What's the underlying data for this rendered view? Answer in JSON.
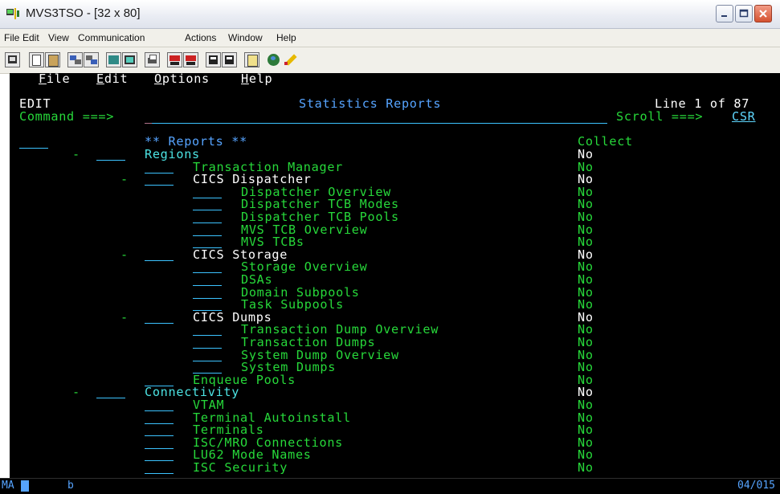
{
  "window": {
    "title": "MVS3TSO - [32 x 80]"
  },
  "menubar": [
    "File",
    "Edit",
    "View",
    "Communication",
    "Actions",
    "Window",
    "Help"
  ],
  "toolbar_icons": [
    "display-icon",
    "copy-icon",
    "paste-icon",
    "send-icon",
    "receive-icon",
    "keypad-icon",
    "screen-icon",
    "print-icon",
    "macro-record-icon",
    "macro-stop-icon",
    "macro-play-icon",
    "macro-pause-icon",
    "clipboard-icon",
    "globe-icon",
    "edit-pencil-icon"
  ],
  "terminal": {
    "actionbar": [
      {
        "hot": "F",
        "rest": "ile"
      },
      {
        "hot": "E",
        "rest": "dit"
      },
      {
        "hot": "O",
        "rest": "ptions"
      },
      {
        "hot": "H",
        "rest": "elp"
      }
    ],
    "mode": "EDIT",
    "panel_title": "Statistics Reports",
    "line_info": "Line 1 of 87",
    "command_label": "Command ===>",
    "command_value": "",
    "scroll_label": "Scroll ===>",
    "scroll_value": "CSR",
    "reports_header": "** Reports **",
    "collect_header": "Collect",
    "rows": [
      {
        "level": 0,
        "dash": true,
        "label": "Regions",
        "collect": "No"
      },
      {
        "level": 1,
        "dash": false,
        "label": "Transaction Manager",
        "collect": "No"
      },
      {
        "level": 1,
        "dash": true,
        "label": "CICS Dispatcher",
        "collect": "No"
      },
      {
        "level": 2,
        "dash": false,
        "label": "Dispatcher Overview",
        "collect": "No"
      },
      {
        "level": 2,
        "dash": false,
        "label": "Dispatcher TCB Modes",
        "collect": "No"
      },
      {
        "level": 2,
        "dash": false,
        "label": "Dispatcher TCB Pools",
        "collect": "No"
      },
      {
        "level": 2,
        "dash": false,
        "label": "MVS TCB Overview",
        "collect": "No"
      },
      {
        "level": 2,
        "dash": false,
        "label": "MVS TCBs",
        "collect": "No"
      },
      {
        "level": 1,
        "dash": true,
        "label": "CICS Storage",
        "collect": "No"
      },
      {
        "level": 2,
        "dash": false,
        "label": "Storage Overview",
        "collect": "No"
      },
      {
        "level": 2,
        "dash": false,
        "label": "DSAs",
        "collect": "No"
      },
      {
        "level": 2,
        "dash": false,
        "label": "Domain Subpools",
        "collect": "No"
      },
      {
        "level": 2,
        "dash": false,
        "label": "Task Subpools",
        "collect": "No"
      },
      {
        "level": 1,
        "dash": true,
        "label": "CICS Dumps",
        "collect": "No"
      },
      {
        "level": 2,
        "dash": false,
        "label": "Transaction Dump Overview",
        "collect": "No"
      },
      {
        "level": 2,
        "dash": false,
        "label": "Transaction Dumps",
        "collect": "No"
      },
      {
        "level": 2,
        "dash": false,
        "label": "System Dump Overview",
        "collect": "No"
      },
      {
        "level": 2,
        "dash": false,
        "label": "System Dumps",
        "collect": "No"
      },
      {
        "level": 1,
        "dash": false,
        "label": "Enqueue Pools",
        "collect": "No"
      },
      {
        "level": 0,
        "dash": true,
        "label": "Connectivity",
        "collect": "No"
      },
      {
        "level": 1,
        "dash": false,
        "label": "VTAM",
        "collect": "No"
      },
      {
        "level": 1,
        "dash": false,
        "label": "Terminal Autoinstall",
        "collect": "No"
      },
      {
        "level": 1,
        "dash": false,
        "label": "Terminals",
        "collect": "No"
      },
      {
        "level": 1,
        "dash": false,
        "label": "ISC/MRO Connections",
        "collect": "No"
      },
      {
        "level": 1,
        "dash": false,
        "label": "LU62 Mode Names",
        "collect": "No"
      },
      {
        "level": 1,
        "dash": false,
        "label": "ISC Security",
        "collect": "No"
      }
    ]
  },
  "status": {
    "mode": "MA",
    "session": "b",
    "cursor_pos": "04/015"
  }
}
